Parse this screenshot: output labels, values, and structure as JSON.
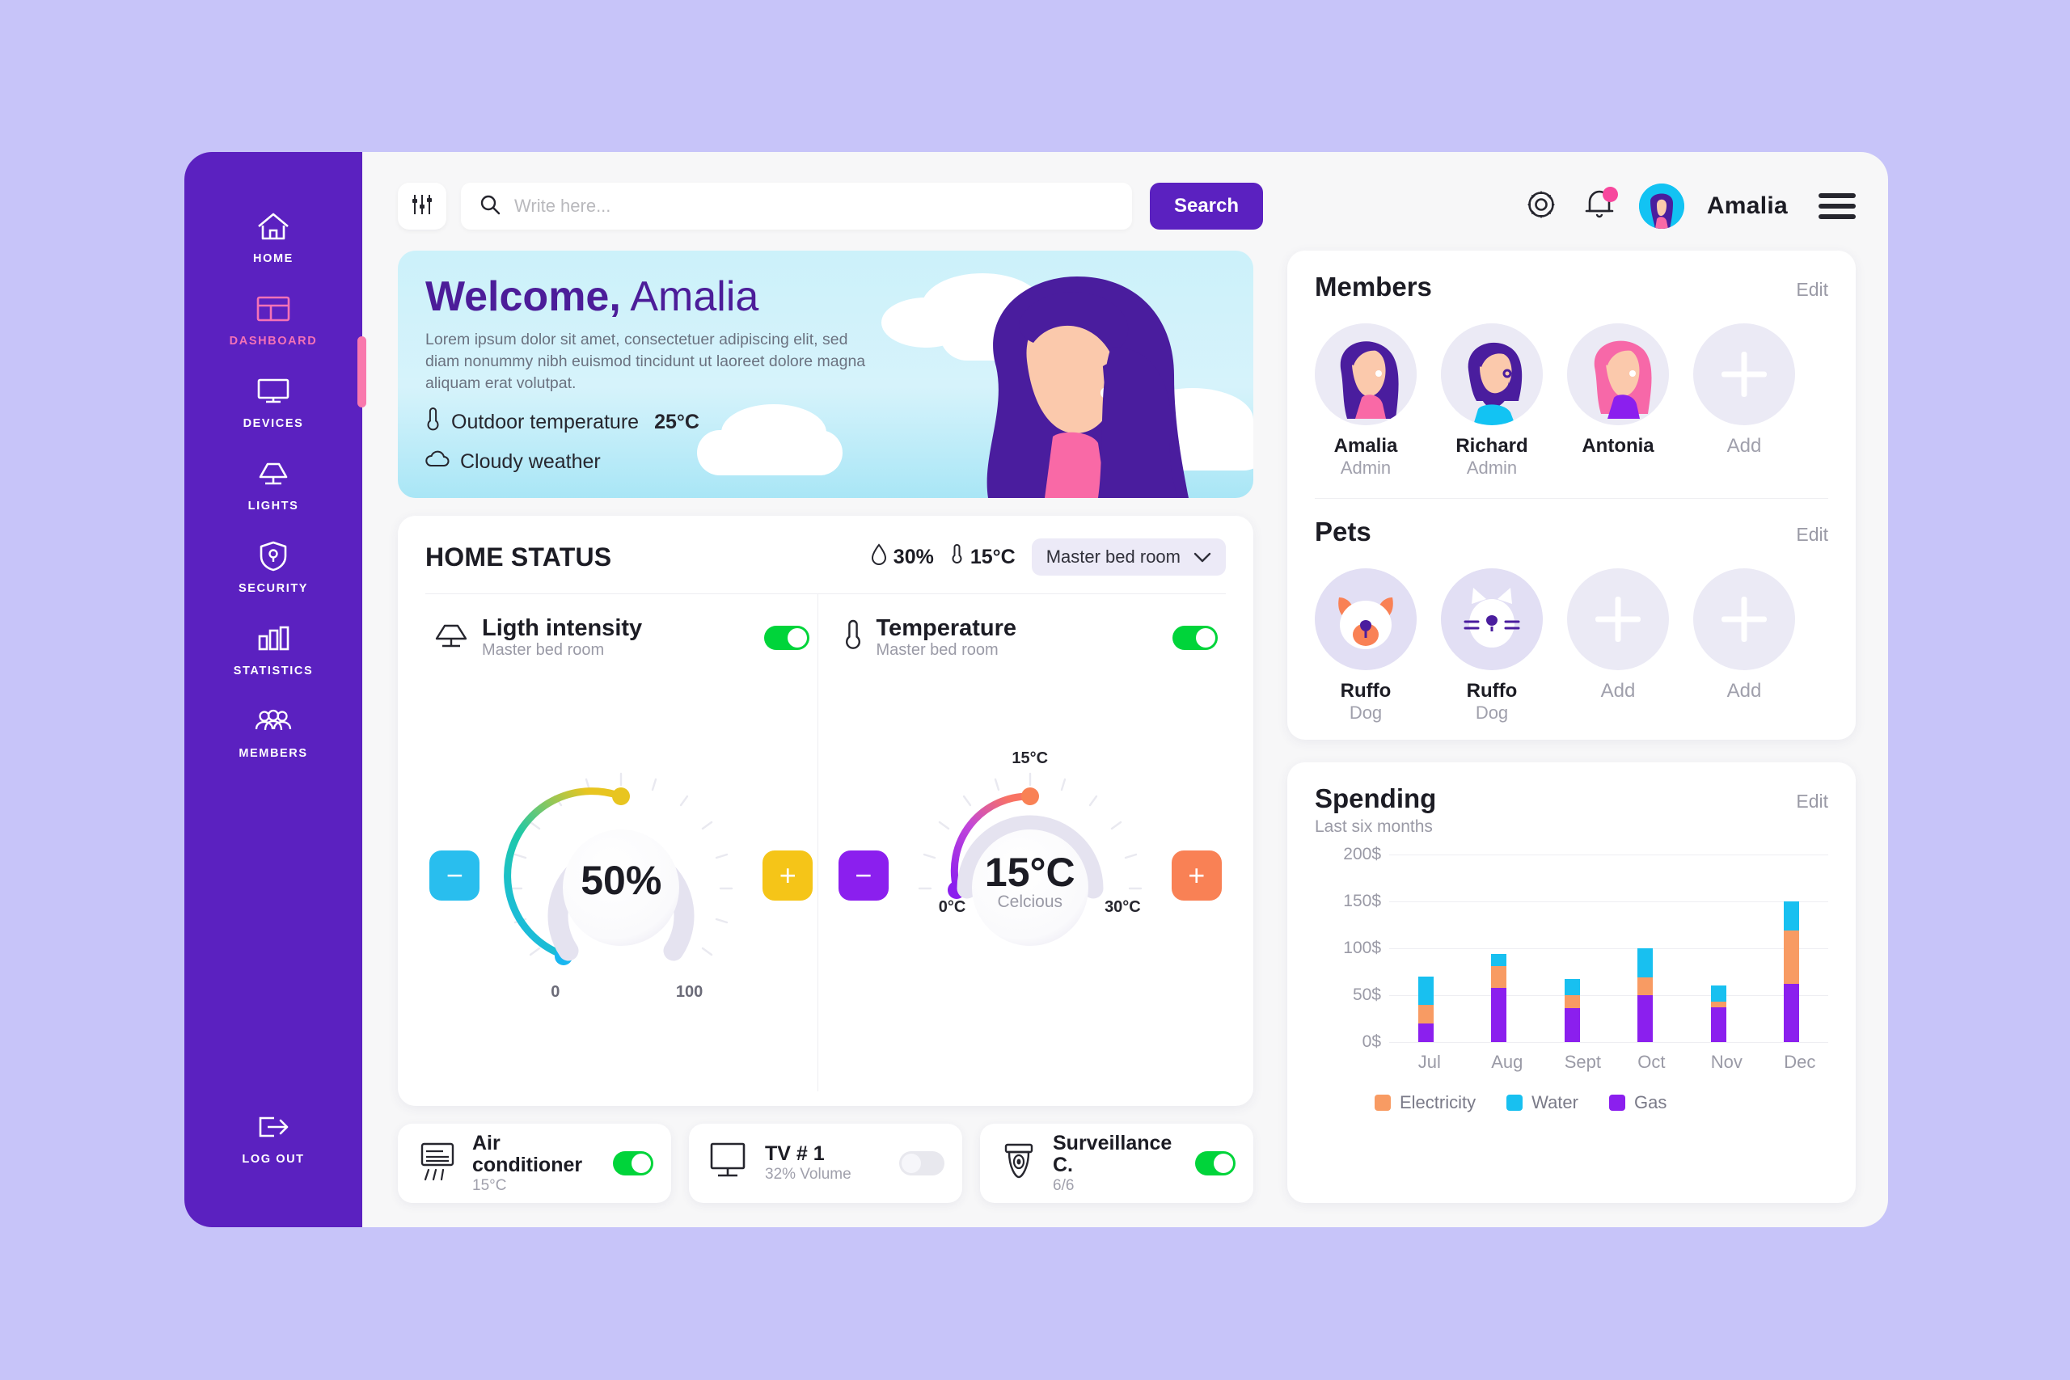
{
  "sidebar": {
    "items": [
      {
        "label": "HOME",
        "icon": "home-icon",
        "active": false
      },
      {
        "label": "DASHBOARD",
        "icon": "dashboard-icon",
        "active": true
      },
      {
        "label": "DEVICES",
        "icon": "monitor-icon",
        "active": false
      },
      {
        "label": "LIGHTS",
        "icon": "lamp-icon",
        "active": false
      },
      {
        "label": "SECURITY",
        "icon": "shield-icon",
        "active": false
      },
      {
        "label": "STATISTICS",
        "icon": "bar-chart-icon",
        "active": false
      },
      {
        "label": "MEMBERS",
        "icon": "people-icon",
        "active": false
      }
    ],
    "logout": {
      "label": "LOG OUT",
      "icon": "logout-icon"
    },
    "bg_color": "#5b21c0",
    "active_color": "#f472b6"
  },
  "header": {
    "filter_icon": "sliders-icon",
    "search": {
      "placeholder": "Write here...",
      "value": "",
      "icon": "search-icon"
    },
    "search_button": "Search",
    "settings_icon": "gear-icon",
    "notifications_icon": "bell-icon",
    "has_notification": true,
    "user_name": "Amalia",
    "menu_icon": "hamburger-icon"
  },
  "banner": {
    "greeting_bold": "Welcome,",
    "greeting_name": " Amalia",
    "description": "Lorem ipsum dolor sit amet, consectetuer adipiscing elit, sed diam nonummy nibh euismod tincidunt ut laoreet dolore magna aliquam erat volutpat.",
    "temperature_label": "Outdoor temperature",
    "temperature_value": "25°C",
    "weather_label": "Cloudy weather",
    "thermometer_icon": "thermometer-icon",
    "cloud_icon": "cloud-icon"
  },
  "home_status": {
    "title": "HOME STATUS",
    "humidity": "30%",
    "humidity_icon": "droplet-icon",
    "temperature": "15°C",
    "temperature_icon": "thermometer-icon",
    "room": "Master bed room",
    "chevron_icon": "chevron-down-icon",
    "light": {
      "title": "Ligth intensity",
      "subtitle": "Master bed room",
      "icon": "lamp-icon",
      "enabled": true,
      "value": "50%",
      "min_label": "0",
      "max_label": "100",
      "minus": "−",
      "plus": "+",
      "minus_color": "#29beee",
      "plus_color": "#f5c518"
    },
    "temperature_control": {
      "title": "Temperature",
      "subtitle": "Master bed room",
      "icon": "thermometer-icon",
      "enabled": true,
      "value": "15°C",
      "unit": "Celcious",
      "top_label": "15°C",
      "min_label": "0°C",
      "max_label": "30°C",
      "minus": "−",
      "plus": "+",
      "minus_color": "#8b1fee",
      "plus_color": "#f98155"
    }
  },
  "devices": [
    {
      "name": "Air  conditioner",
      "status": "15°C",
      "icon": "air-conditioner-icon",
      "enabled": true
    },
    {
      "name": "TV # 1",
      "status": "32% Volume",
      "icon": "tv-icon",
      "enabled": false
    },
    {
      "name": "Surveillance C.",
      "status": "6/6",
      "icon": "camera-icon",
      "enabled": true
    }
  ],
  "members": {
    "title": "Members",
    "edit": "Edit",
    "people": [
      {
        "name": "Amalia",
        "role": "Admin",
        "type": "woman-purple"
      },
      {
        "name": "Richard",
        "role": "Admin",
        "type": "man-beard"
      },
      {
        "name": "Antonia",
        "role": "",
        "type": "woman-pink"
      },
      {
        "name": "Add",
        "role": "",
        "type": "add"
      }
    ]
  },
  "pets": {
    "title": "Pets",
    "edit": "Edit",
    "list": [
      {
        "name": "Ruffo",
        "role": "Dog",
        "type": "dog"
      },
      {
        "name": "Ruffo",
        "role": "Dog",
        "type": "cat"
      },
      {
        "name": "Add",
        "role": "",
        "type": "add"
      },
      {
        "name": "Add",
        "role": "",
        "type": "add"
      }
    ]
  },
  "spending": {
    "title": "Spending",
    "subtitle": "Last six months",
    "edit": "Edit"
  },
  "chart_data": {
    "type": "bar",
    "title": "Spending",
    "subtitle": "Last six months",
    "stacked": true,
    "categories": [
      "Jul",
      "Aug",
      "Sept",
      "Oct",
      "Nov",
      "Dec"
    ],
    "series": [
      {
        "name": "Gas",
        "color": "#8b1fee",
        "values": [
          20,
          58,
          36,
          50,
          37,
          62
        ]
      },
      {
        "name": "Electricity",
        "color": "#f89b63",
        "values": [
          20,
          23,
          14,
          19,
          6,
          57
        ]
      },
      {
        "name": "Water",
        "color": "#18c0f0",
        "values": [
          30,
          13,
          17,
          31,
          17,
          31
        ]
      }
    ],
    "ylabel": "",
    "xlabel": "",
    "ylim": [
      0,
      200
    ],
    "yticks": [
      0,
      50,
      100,
      150,
      200
    ],
    "ytick_labels": [
      "0$",
      "50$",
      "100$",
      "150$",
      "200$"
    ],
    "grid": true,
    "legend_position": "bottom"
  }
}
